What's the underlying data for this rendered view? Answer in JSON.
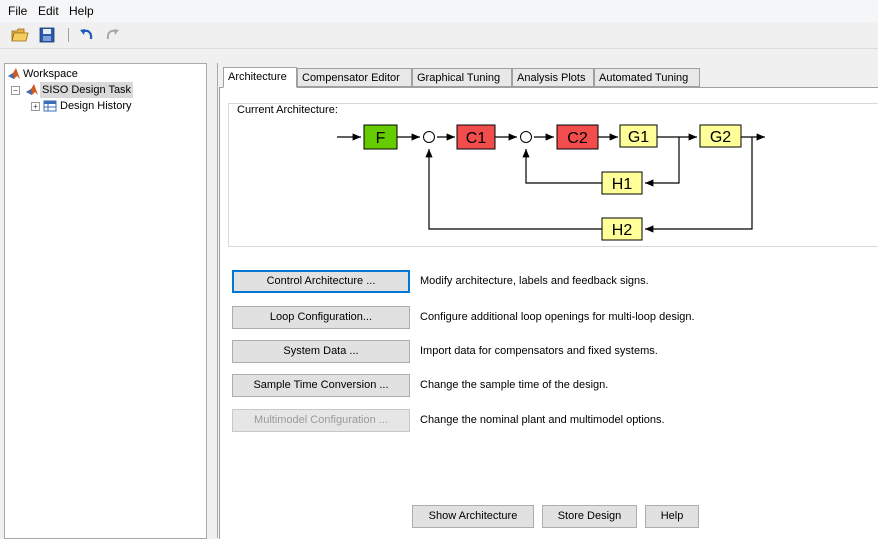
{
  "menubar": {
    "items": [
      "File",
      "Edit",
      "Help"
    ]
  },
  "toolbar": {
    "icons": [
      "open-folder-icon",
      "save-icon",
      "undo-icon",
      "redo-icon"
    ]
  },
  "tree": {
    "workspace": "Workspace",
    "task": "SISO Design Task",
    "history": "Design History"
  },
  "tabs": [
    "Architecture",
    "Compensator Editor",
    "Graphical Tuning",
    "Analysis Plots",
    "Automated Tuning"
  ],
  "architecture": {
    "title": "Current Architecture:",
    "blocks": {
      "F": "F",
      "C1": "C1",
      "C2": "C2",
      "G1": "G1",
      "G2": "G2",
      "H1": "H1",
      "H2": "H2"
    },
    "colors": {
      "F": "#66cc00",
      "C": "#f24d4d",
      "plant": "#ffff99"
    }
  },
  "actions": [
    {
      "label": "Control Architecture ...",
      "desc": "Modify architecture, labels and feedback signs."
    },
    {
      "label": "Loop Configuration...",
      "desc": "Configure additional loop openings for multi-loop design."
    },
    {
      "label": "System Data ...",
      "desc": "Import data for compensators and fixed systems."
    },
    {
      "label": "Sample Time Conversion ...",
      "desc": "Change the sample time of the design."
    },
    {
      "label": "Multimodel Configuration ...",
      "desc": "Change the nominal plant and multimodel options."
    }
  ],
  "bottom": {
    "show": "Show Architecture",
    "store": "Store Design",
    "help": "Help"
  }
}
